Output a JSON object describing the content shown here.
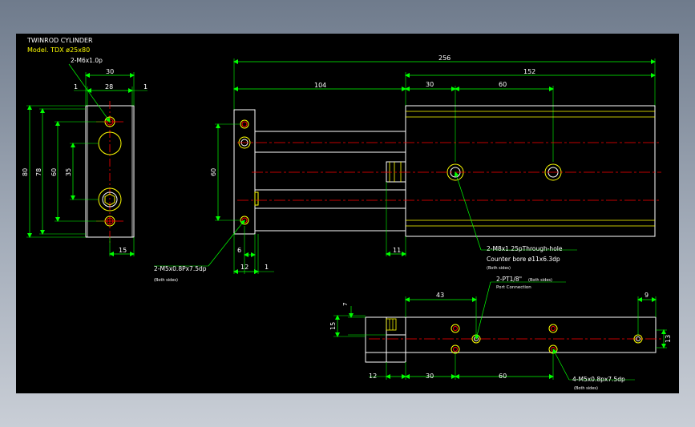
{
  "title": {
    "line1": "TWINROD CYLINDER",
    "line2": "Model. TDX ø25x80"
  },
  "colors": {
    "background": "#000000",
    "outline": "#ffffff",
    "dimension": "#00ff00",
    "centerline": "#ff0000",
    "rod_line": "#ffff00"
  },
  "left_view": {
    "dims": {
      "w30": "30",
      "w28": "28",
      "e1a": "1",
      "e1b": "1",
      "h80": "80",
      "h78": "78",
      "h60": "60",
      "h35": "35",
      "w15": "15"
    },
    "notes": {
      "m6": "2-M6x1.0p"
    }
  },
  "front_view": {
    "dims": {
      "total": "256",
      "d104": "104",
      "d152": "152",
      "d30": "30",
      "d60": "60",
      "h60": "60",
      "d6": "6",
      "d12": "12",
      "d1": "1",
      "d11": "11"
    },
    "notes": {
      "m5_top": "2-M5x0.8Px7.5dp",
      "m5_top_sub": "(Both sides)",
      "m8": "2-M8x1.25pThrough-hole",
      "m8_cb": "Counter bore ø11x6.3dp",
      "m8_sub": "(Both sides)"
    }
  },
  "bottom_view": {
    "dims": {
      "d43": "43",
      "d9": "9",
      "d7": "7",
      "d15": "15",
      "d13": "13",
      "d12": "12",
      "d30": "30",
      "d60": "60"
    },
    "notes": {
      "pt": "2-PT1/8\"",
      "pt_sub": "(Both sides)",
      "pt_port": "Port Connection",
      "m5_bot": "4-M5x0.8px7.5dp",
      "m5_bot_sub": "(Both sides)"
    }
  }
}
